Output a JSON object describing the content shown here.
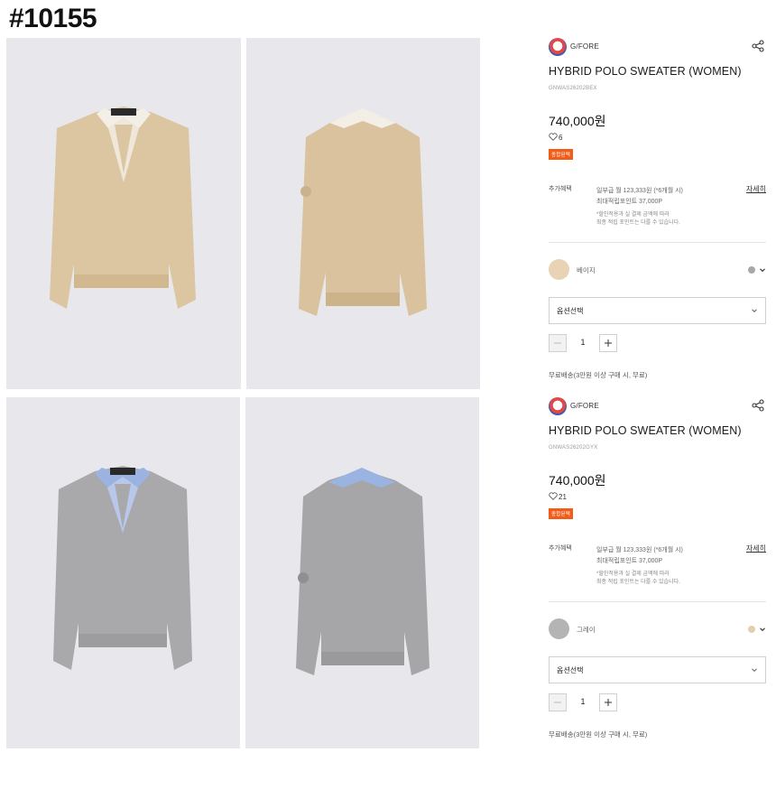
{
  "page_id": "#10155",
  "products": [
    {
      "brand": "G/FORE",
      "title": "HYBRID POLO SWEATER (WOMEN)",
      "code": "GNWAS26202BEX",
      "price": "740,000원",
      "likes": "6",
      "badge": "종합된택",
      "benefit_label": "추가혜택",
      "benefit_line1": "일부급 월 123,333원 (*6개월 시)",
      "benefit_line2": "최대적립포인트 37,000P",
      "benefit_note1": "*할인적용과 실 결제 금액에 따라",
      "benefit_note2": "최종 적립 포인트는 다를 수 있습니다.",
      "detail_link": "자세히",
      "color_name": "베이지",
      "select_label": "옵션선택",
      "quantity": "1",
      "shipping": "무료배송(3만원 이상 구매 시, 무료)",
      "colors": {
        "swatch": "#e8d3b4",
        "alt_swatch": "#a8a8a8"
      },
      "icons": [
        "brand-logo-icon",
        "share-icon",
        "heart-icon",
        "chevron-down-icon",
        "minus-icon",
        "plus-icon"
      ]
    },
    {
      "brand": "G/FORE",
      "title": "HYBRID POLO SWEATER (WOMEN)",
      "code": "GNWAS26202GYX",
      "price": "740,000원",
      "likes": "21",
      "badge": "종합된택",
      "benefit_label": "추가혜택",
      "benefit_line1": "일부급 월 123,333원 (*6개월 시)",
      "benefit_line2": "최대적립포인트 37,000P",
      "benefit_note1": "*할인적용과 실 결제 금액에 따라",
      "benefit_note2": "최종 적립 포인트는 다를 수 있습니다.",
      "detail_link": "자세히",
      "color_name": "그레이",
      "select_label": "옵션선택",
      "quantity": "1",
      "shipping": "무료배송(3만원 이상 구매 시, 무료)",
      "colors": {
        "swatch": "#b4b4b4",
        "alt_swatch": "#e3cfae"
      },
      "icons": [
        "brand-logo-icon",
        "share-icon",
        "heart-icon",
        "chevron-down-icon",
        "minus-icon",
        "plus-icon"
      ]
    }
  ],
  "photos": [
    {
      "name": "beige-front-photo",
      "sweater_color": "#dcc6a2",
      "collar_color": "#f3efe6"
    },
    {
      "name": "beige-back-photo",
      "sweater_color": "#d9c29d",
      "collar_color": "#f3efe6"
    },
    {
      "name": "gray-front-photo",
      "sweater_color": "#a9a9ab",
      "collar_color": "#9bb3e0"
    },
    {
      "name": "gray-back-photo",
      "sweater_color": "#a6a6a8",
      "collar_color": "#9bb3e0"
    }
  ]
}
